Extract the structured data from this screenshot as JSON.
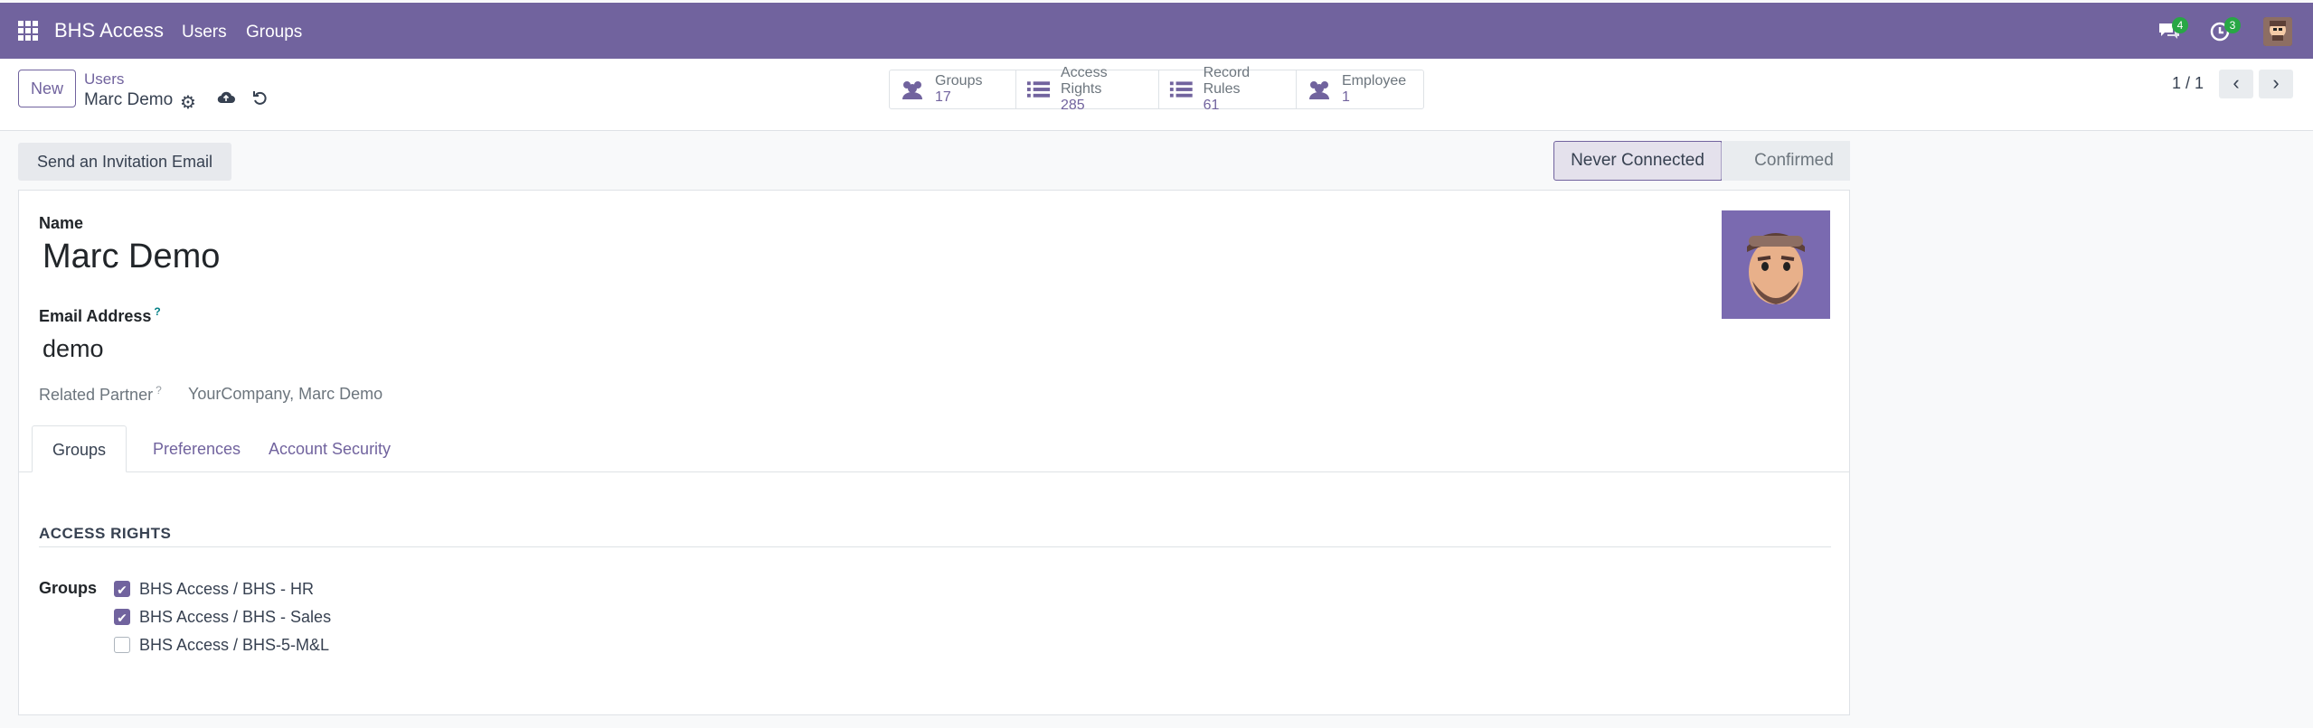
{
  "topbar": {
    "app_title": "BHS Access",
    "menu": [
      "Users",
      "Groups"
    ],
    "messages_count": "4",
    "activities_count": "3"
  },
  "control": {
    "new_label": "New",
    "breadcrumb_parent": "Users",
    "breadcrumb_current": "Marc Demo",
    "stats": [
      {
        "label": "Groups",
        "value": "17",
        "icon": "users-icon"
      },
      {
        "label": "Access Rights",
        "value": "285",
        "icon": "list-icon"
      },
      {
        "label": "Record Rules",
        "value": "61",
        "icon": "list-icon"
      },
      {
        "label": "Employee",
        "value": "1",
        "icon": "users-icon"
      }
    ],
    "pager": "1 / 1"
  },
  "status": {
    "invite_label": "Send an Invitation Email",
    "stages": [
      "Never Connected",
      "Confirmed"
    ],
    "active_stage": "Never Connected"
  },
  "form": {
    "name_label": "Name",
    "name_value": "Marc Demo",
    "email_label": "Email Address",
    "email_help": "?",
    "email_value": "demo",
    "partner_label": "Related Partner",
    "partner_help": "?",
    "partner_value": "YourCompany, Marc Demo",
    "tabs": [
      "Groups",
      "Preferences",
      "Account Security"
    ],
    "active_tab": "Groups",
    "section_title": "ACCESS RIGHTS",
    "groups_label": "Groups",
    "groups": [
      {
        "label": "BHS Access / BHS - HR",
        "checked": true
      },
      {
        "label": "BHS Access / BHS - Sales",
        "checked": true
      },
      {
        "label": "BHS Access / BHS-5-M&L",
        "checked": false
      }
    ]
  },
  "colors": {
    "brand": "#71639e",
    "badge": "#28a745"
  }
}
